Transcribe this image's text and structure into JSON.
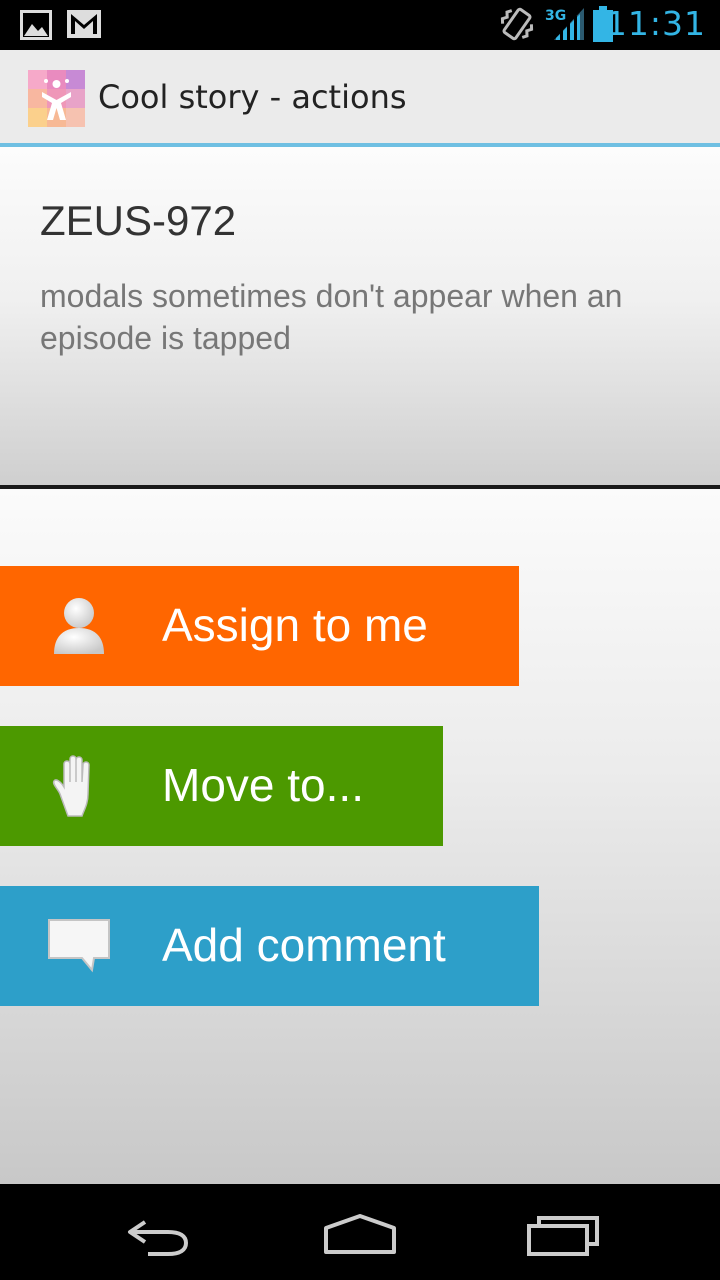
{
  "status_bar": {
    "time": "11:31",
    "network": "3G",
    "icons": [
      "picture-icon",
      "gmail-icon",
      "vibrate-icon",
      "signal-icon",
      "battery-icon"
    ]
  },
  "action_bar": {
    "title": "Cool story - actions",
    "logo_icon": "jira-logo-icon"
  },
  "issue": {
    "key": "ZEUS-972",
    "summary": "modals sometimes don't appear when an episode is tapped"
  },
  "actions": [
    {
      "label": "Assign to me",
      "icon": "person-icon",
      "color": "#ff6600"
    },
    {
      "label": "Move to...",
      "icon": "hand-icon",
      "color": "#4c9900"
    },
    {
      "label": "Add comment",
      "icon": "comment-icon",
      "color": "#2d9fc9"
    }
  ],
  "nav_bar": {
    "icons": [
      "back-icon",
      "home-icon",
      "recent-apps-icon"
    ]
  }
}
